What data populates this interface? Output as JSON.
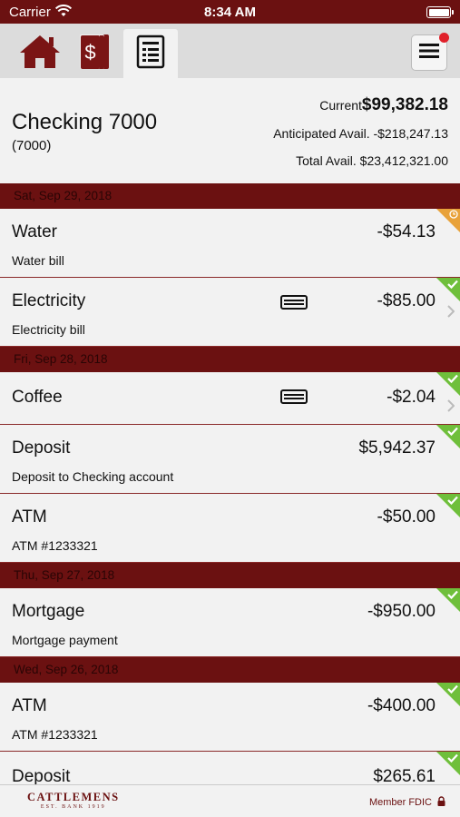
{
  "status_bar": {
    "carrier": "Carrier",
    "time": "8:34 AM"
  },
  "nav": {
    "tabs": [
      {
        "icon": "home-icon"
      },
      {
        "icon": "dollar-cards-icon"
      },
      {
        "icon": "document-list-icon"
      }
    ],
    "menu_icon": "hamburger-menu-icon",
    "active_tab": 2
  },
  "account": {
    "name": "Checking 7000",
    "number": "(7000)",
    "current_label": "Current",
    "current_amount": "$99,382.18",
    "anticipated": "Anticipated Avail. -$218,247.13",
    "total": "Total Avail. $23,412,321.00"
  },
  "groups": [
    {
      "date": "Sat, Sep 29, 2018",
      "transactions": [
        {
          "title": "Water",
          "amount": "-$54.13",
          "desc": "Water bill",
          "status": "pending"
        },
        {
          "title": "Electricity",
          "amount": "-$85.00",
          "desc": "Electricity bill",
          "status": "cleared",
          "card": true,
          "chevron": true
        }
      ]
    },
    {
      "date": "Fri, Sep 28, 2018",
      "transactions": [
        {
          "title": "Coffee",
          "amount": "-$2.04",
          "status": "cleared",
          "card": true,
          "chevron": true
        },
        {
          "title": "Deposit",
          "amount": "$5,942.37",
          "desc": "Deposit to Checking account",
          "status": "cleared"
        },
        {
          "title": "ATM",
          "amount": "-$50.00",
          "desc": "ATM #1233321",
          "status": "cleared"
        }
      ]
    },
    {
      "date": "Thu, Sep 27, 2018",
      "transactions": [
        {
          "title": "Mortgage",
          "amount": "-$950.00",
          "desc": "Mortgage payment",
          "status": "cleared"
        }
      ]
    },
    {
      "date": "Wed, Sep 26, 2018",
      "transactions": [
        {
          "title": "ATM",
          "amount": "-$400.00",
          "desc": "ATM #1233321",
          "status": "cleared"
        },
        {
          "title": "Deposit",
          "amount": "$265.61",
          "status": "cleared"
        }
      ]
    }
  ],
  "footer": {
    "bank_name": "CATTLEMENS",
    "bank_sub": "EST. BANK 1919",
    "fdic": "Member FDIC"
  },
  "colors": {
    "brand": "#6b1111",
    "cleared": "#6fbf3b",
    "pending": "#e8a23a"
  }
}
